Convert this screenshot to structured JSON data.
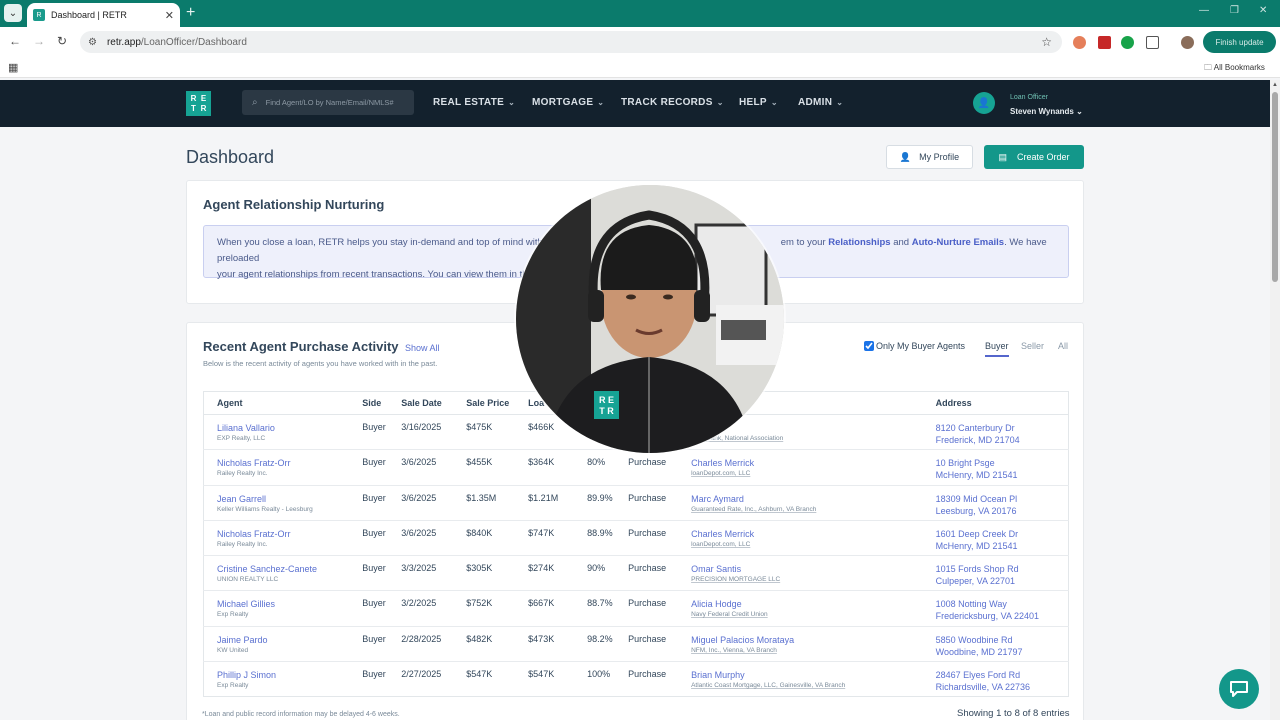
{
  "browser": {
    "tab_title": "Dashboard | RETR",
    "url_host": "retr.app",
    "url_path": "/LoanOfficer/Dashboard",
    "finish_update": "Finish update",
    "all_bookmarks": "All Bookmarks"
  },
  "nav": {
    "logo_letters": [
      "R",
      "E",
      "T",
      "R"
    ],
    "search_placeholder": "Find Agent/LO by Name/Email/NMLS#",
    "menus": [
      "REAL ESTATE",
      "MORTGAGE",
      "TRACK RECORDS",
      "HELP",
      "ADMIN"
    ],
    "user_role": "Loan Officer",
    "user_name": "Steven Wynands"
  },
  "page": {
    "title": "Dashboard",
    "my_profile": "My Profile",
    "create_order": "Create Order"
  },
  "nurturing": {
    "title": "Agent Relationship Nurturing",
    "text1": "When you close a loan, RETR helps you stay in-demand and top of mind with b",
    "text2": "em to your ",
    "link1": "Relationships",
    "and": " and ",
    "link2": "Auto-Nurture Emails",
    "text3": ". We have preloaded",
    "text4": "your agent relationships from recent transactions. You can view them in the"
  },
  "activity": {
    "title": "Recent Agent Purchase Activity",
    "show_all": "Show All",
    "subtitle": "Below is the recent activity of agents you have worked with in the past.",
    "only_buyer": "Only My Buyer Agents",
    "segments": [
      "Buyer",
      "Seller",
      "All"
    ],
    "columns": [
      "Agent",
      "Side",
      "Sale Date",
      "Sale Price",
      "Loa",
      "",
      "",
      "",
      "Address"
    ],
    "rows": [
      {
        "agent": "Liliana Vallario",
        "agent_co": "EXP Realty, LLC",
        "side": "Buyer",
        "date": "3/16/2025",
        "price": "$475K",
        "loan": "$466K",
        "ltv": "",
        "type": "",
        "lo": "rdy",
        "lo_co": "ncial Bank, National Association",
        "addr1": "8120 Canterbury Dr",
        "addr2": "Frederick, MD 21704"
      },
      {
        "agent": "Nicholas Fratz-Orr",
        "agent_co": "Railey Realty Inc.",
        "side": "Buyer",
        "date": "3/6/2025",
        "price": "$455K",
        "loan": "$364K",
        "ltv": "80%",
        "type": "Purchase",
        "lo": "Charles Merrick",
        "lo_co": "loanDepot.com, LLC",
        "addr1": "10 Bright Psge",
        "addr2": "McHenry, MD 21541"
      },
      {
        "agent": "Jean Garrell",
        "agent_co": "Keller Williams Realty - Leesburg",
        "side": "Buyer",
        "date": "3/6/2025",
        "price": "$1.35M",
        "loan": "$1.21M",
        "ltv": "89.9%",
        "type": "Purchase",
        "lo": "Marc Aymard",
        "lo_co": "Guaranteed Rate, Inc., Ashburn, VA Branch",
        "addr1": "18309 Mid Ocean Pl",
        "addr2": "Leesburg, VA 20176"
      },
      {
        "agent": "Nicholas Fratz-Orr",
        "agent_co": "Railey Realty Inc.",
        "side": "Buyer",
        "date": "3/6/2025",
        "price": "$840K",
        "loan": "$747K",
        "ltv": "88.9%",
        "type": "Purchase",
        "lo": "Charles Merrick",
        "lo_co": "loanDepot.com, LLC",
        "addr1": "1601 Deep Creek Dr",
        "addr2": "McHenry, MD 21541"
      },
      {
        "agent": "Cristine Sanchez-Canete",
        "agent_co": "UNION REALTY LLC",
        "side": "Buyer",
        "date": "3/3/2025",
        "price": "$305K",
        "loan": "$274K",
        "ltv": "90%",
        "type": "Purchase",
        "lo": "Omar Santis",
        "lo_co": "PRECISION MORTGAGE LLC",
        "addr1": "1015 Fords Shop Rd",
        "addr2": "Culpeper, VA 22701"
      },
      {
        "agent": "Michael Gillies",
        "agent_co": "Exp Realty",
        "side": "Buyer",
        "date": "3/2/2025",
        "price": "$752K",
        "loan": "$667K",
        "ltv": "88.7%",
        "type": "Purchase",
        "lo": "Alicia Hodge",
        "lo_co": "Navy Federal Credit Union",
        "addr1": "1008 Notting Way",
        "addr2": "Fredericksburg, VA 22401"
      },
      {
        "agent": "Jaime Pardo",
        "agent_co": "KW United",
        "side": "Buyer",
        "date": "2/28/2025",
        "price": "$482K",
        "loan": "$473K",
        "ltv": "98.2%",
        "type": "Purchase",
        "lo": "Miguel Palacios Morataya",
        "lo_co": "NFM, Inc., Vienna, VA Branch",
        "addr1": "5850 Woodbine Rd",
        "addr2": "Woodbine, MD 21797"
      },
      {
        "agent": "Phillip J Simon",
        "agent_co": "Exp Realty",
        "side": "Buyer",
        "date": "2/27/2025",
        "price": "$547K",
        "loan": "$547K",
        "ltv": "100%",
        "type": "Purchase",
        "lo": "Brian Murphy",
        "lo_co": "Atlantic Coast Mortgage, LLC, Gainesville, VA Branch",
        "addr1": "28467 Elyes Ford Rd",
        "addr2": "Richardsville, VA 22736"
      }
    ],
    "footnote": "*Loan and public record information may be delayed 4-6 weeks.",
    "showing": "Showing 1 to 8 of 8 entries"
  },
  "webcam_badge": [
    "R",
    "E",
    "T",
    "R"
  ],
  "colors": {
    "brand": "#16a394",
    "nav_bg": "#13212d",
    "link": "#5a70d0"
  }
}
